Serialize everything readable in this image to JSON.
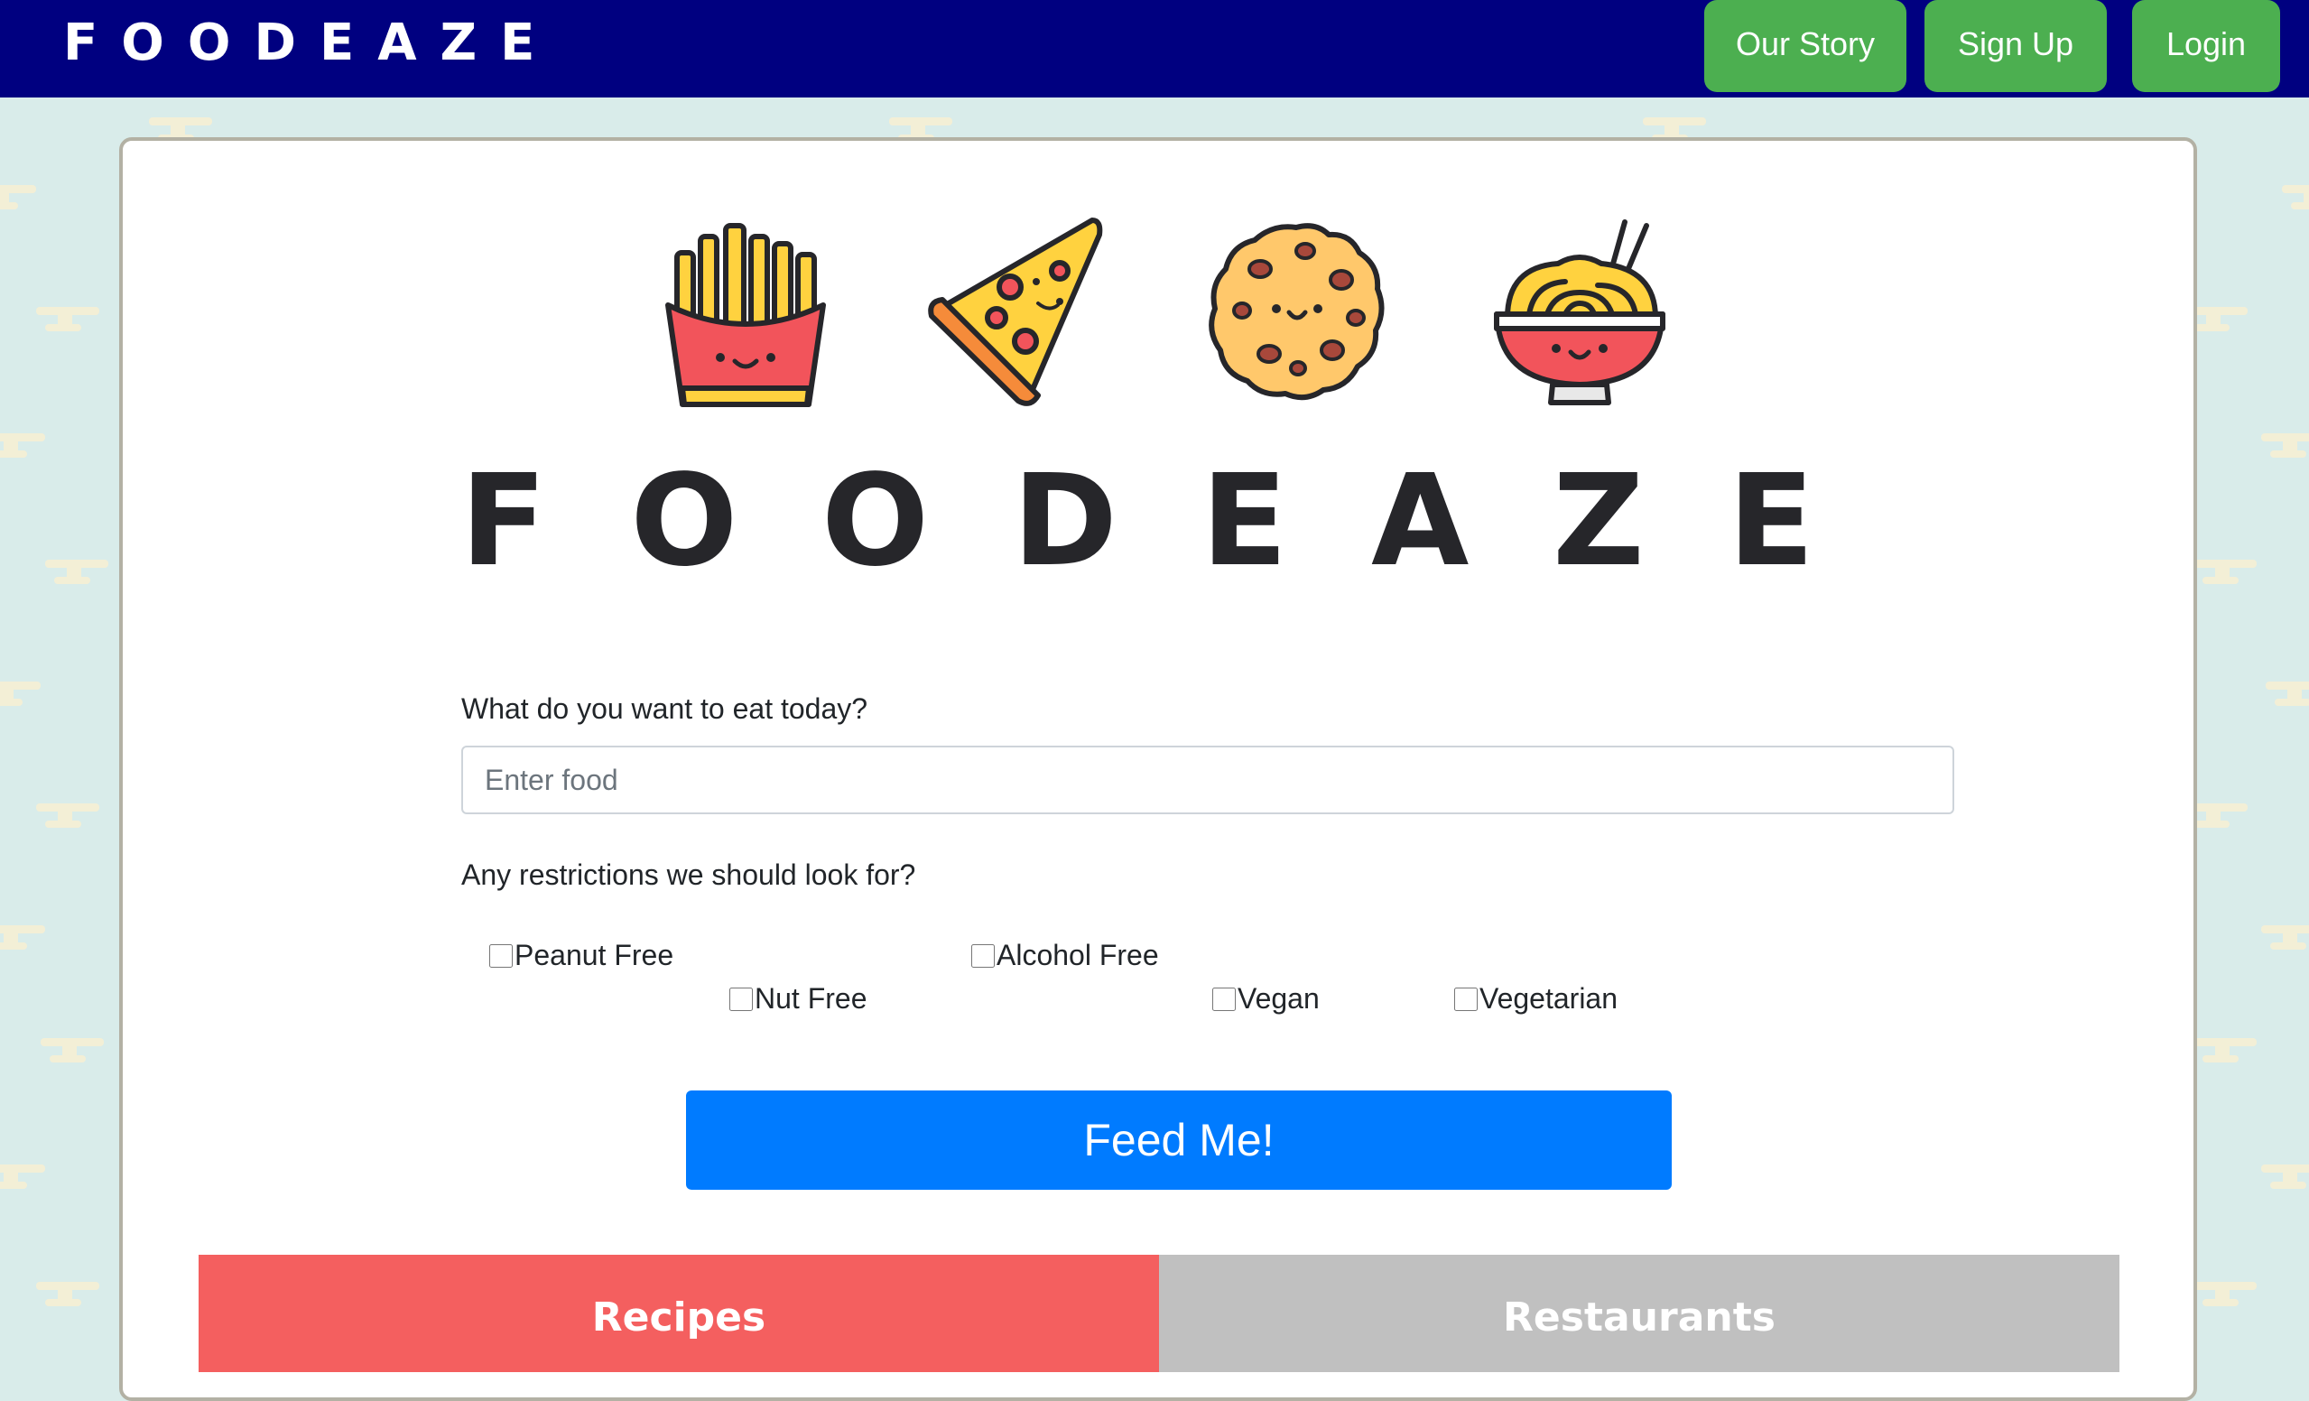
{
  "brand": {
    "name": "FOODEAZE"
  },
  "nav": {
    "our_story": "Our Story",
    "sign_up": "Sign Up",
    "login": "Login"
  },
  "hero": {
    "icons": [
      "fries-icon",
      "pizza-icon",
      "cookie-icon",
      "noodles-icon"
    ],
    "letters": [
      "F",
      "O",
      "O",
      "D",
      "E",
      "A",
      "Z",
      "E"
    ]
  },
  "form": {
    "food_label": "What do you want to eat today?",
    "food_placeholder": "Enter food",
    "food_value": "",
    "restrictions_label": "Any restrictions we should look for?",
    "restrictions": [
      {
        "label": "Peanut Free",
        "checked": false
      },
      {
        "label": "Nut Free",
        "checked": false
      },
      {
        "label": "Alcohol Free",
        "checked": false
      },
      {
        "label": "Vegan",
        "checked": false
      },
      {
        "label": "Vegetarian",
        "checked": false
      }
    ],
    "submit_label": "Feed Me!"
  },
  "tabs": [
    {
      "label": "Recipes",
      "active": true
    },
    {
      "label": "Restaurants",
      "active": false
    }
  ],
  "colors": {
    "navbar": "#000080",
    "nav_button": "#4caf50",
    "background": "#d9ecea",
    "primary_button": "#007bff",
    "tab_active": "#f45f5f",
    "tab_inactive": "#c0c0c0"
  }
}
